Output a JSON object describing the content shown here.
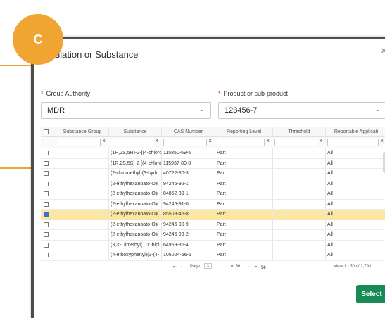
{
  "badge": {
    "letter": "C"
  },
  "dialog": {
    "title": "ulation or Substance",
    "close_glyph": "×"
  },
  "form": {
    "group_authority": {
      "label": "Group Authority",
      "value": "MDR"
    },
    "product": {
      "label": "Product or sub-product",
      "value": "123456-7"
    }
  },
  "table": {
    "columns": [
      "Substance Group",
      "Substance",
      "CAS Number",
      "Reporting Level",
      "Threshold",
      "Reportable Applicati"
    ],
    "rows": [
      {
        "substance_group": "",
        "substance": "(1R,2S,5R)-2-[(4-chloro",
        "cas": "115850-69-6",
        "reporting_level": "Part",
        "threshold": "",
        "reportable_app": "All",
        "selected": false
      },
      {
        "substance_group": "",
        "substance": "(1R,2S,5S)-2-[(4-chloro",
        "cas": "115937-89-8",
        "reporting_level": "Part",
        "threshold": "",
        "reportable_app": "All",
        "selected": false
      },
      {
        "substance_group": "",
        "substance": "(2-chloroethyl)(3-hydr",
        "cas": "40722-80-3",
        "reporting_level": "Part",
        "threshold": "",
        "reportable_app": "All",
        "selected": false
      },
      {
        "substance_group": "",
        "substance": "(2-ethylhexanoato-O)(",
        "cas": "94246-92-1",
        "reporting_level": "Part",
        "threshold": "",
        "reportable_app": "All",
        "selected": false
      },
      {
        "substance_group": "",
        "substance": "(2-ethylhexanoato-O)(",
        "cas": "84852-39-1",
        "reporting_level": "Part",
        "threshold": "",
        "reportable_app": "All",
        "selected": false
      },
      {
        "substance_group": "",
        "substance": "(2-ethylhexanoato-O)(",
        "cas": "94246-91-0",
        "reporting_level": "Part",
        "threshold": "",
        "reportable_app": "All",
        "selected": false
      },
      {
        "substance_group": "",
        "substance": "(2-ethylhexanoato-O)(",
        "cas": "85508-45-8",
        "reporting_level": "Part",
        "threshold": "",
        "reportable_app": "All",
        "selected": true
      },
      {
        "substance_group": "",
        "substance": "(2-ethylhexanoato-O)(",
        "cas": "94246-90-9",
        "reporting_level": "Part",
        "threshold": "",
        "reportable_app": "All",
        "selected": false
      },
      {
        "substance_group": "",
        "substance": "(2-ethylhexanoato-O)(",
        "cas": "94246-93-2",
        "reporting_level": "Part",
        "threshold": "",
        "reportable_app": "All",
        "selected": false
      },
      {
        "substance_group": "",
        "substance": "(3,3'-Dimethyl(1,1'-bipl",
        "cas": "64969-36-4",
        "reporting_level": "Part",
        "threshold": "",
        "reportable_app": "All",
        "selected": false
      },
      {
        "substance_group": "",
        "substance": "(4-ethoxyphenyl)(3-(4-",
        "cas": "105024-66-6",
        "reporting_level": "Part",
        "threshold": "",
        "reportable_app": "All",
        "selected": false
      }
    ]
  },
  "pager": {
    "page_label": "Page",
    "page_value": "1",
    "of_text": "of 56",
    "page_size": "50",
    "view_text": "View 1 - 50 of 2,793",
    "first_glyph": "⇤",
    "prev_glyph": "←",
    "next_glyph": "→",
    "last_glyph": "⇥"
  },
  "actions": {
    "select_label": "Select"
  },
  "colors": {
    "accent": "#f0a432",
    "primary_button": "#178a55",
    "selected_row": "#fbe6a3"
  }
}
